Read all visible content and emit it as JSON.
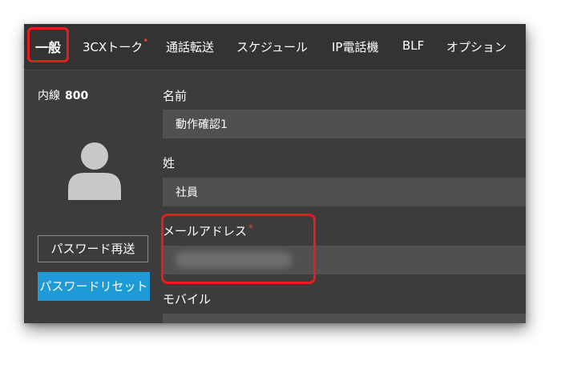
{
  "tabs": [
    {
      "label": "一般",
      "active": true
    },
    {
      "label": "3CXトーク",
      "required": true,
      "required_mark": "•"
    },
    {
      "label": "通話転送"
    },
    {
      "label": "スケジュール"
    },
    {
      "label": "IP電話機"
    },
    {
      "label": "BLF"
    },
    {
      "label": "オプション"
    }
  ],
  "sidebar": {
    "extension_label": "内線",
    "extension_number": "800",
    "avatar_icon": "user-avatar-icon",
    "resend_password_label": "パスワード再送",
    "reset_password_label": "パスワードリセット"
  },
  "form": {
    "first_name": {
      "label": "名前",
      "value": "動作確認1"
    },
    "last_name": {
      "label": "姓",
      "value": "社員"
    },
    "email": {
      "label": "メールアドレス",
      "required_mark": "*",
      "value": ""
    },
    "mobile": {
      "label": "モバイル",
      "value": ""
    }
  },
  "colors": {
    "background": "#3c3c3c",
    "field": "#505050",
    "accent": "#1e9ad6",
    "highlight": "#e41e1e",
    "required": "#e0413b"
  }
}
